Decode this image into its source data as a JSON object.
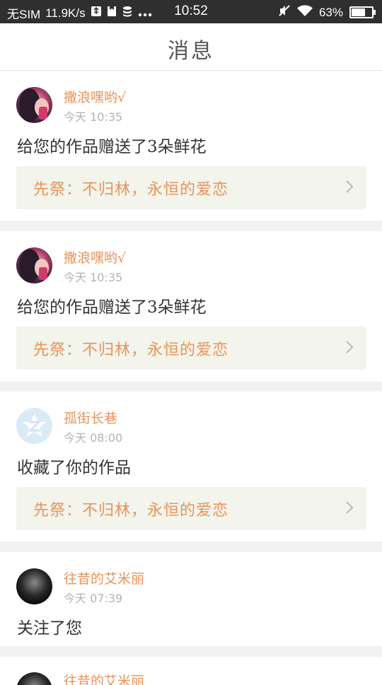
{
  "status_bar": {
    "carrier": "无SIM",
    "speed": "11.9K/s",
    "time": "10:52",
    "battery": "63%",
    "battery_level": 0.63,
    "icons": [
      "usb-icon",
      "sim-icon",
      "storage-icon",
      "more-dots-icon",
      "mute-icon",
      "wifi-icon",
      "battery-icon"
    ]
  },
  "header": {
    "title": "消息"
  },
  "colors": {
    "accent": "#e8935a",
    "link_bg": "#f3f4ec",
    "text": "#333333",
    "muted": "#b3b3b3"
  },
  "messages": [
    {
      "nick": "撒浪嘿哟√",
      "time": "今天 10:35",
      "text": "给您的作品赠送了3朵鲜花",
      "work": "先祭：不归林，永恒的爱恋",
      "avatar": "girl-avatar"
    },
    {
      "nick": "撒浪嘿哟√",
      "time": "今天 10:35",
      "text": "给您的作品赠送了3朵鲜花",
      "work": "先祭：不归林，永恒的爱恋",
      "avatar": "girl-avatar"
    },
    {
      "nick": "孤街长巷",
      "time": "今天 08:00",
      "text": "收藏了你的作品",
      "work": "先祭：不归林，永恒的爱恋",
      "avatar": "qq-avatar"
    },
    {
      "nick": "往昔的艾米丽",
      "time": "今天 07:39",
      "text": "关注了您",
      "avatar": "dark-avatar"
    },
    {
      "nick": "往昔的艾米丽",
      "avatar": "dark-avatar"
    }
  ]
}
